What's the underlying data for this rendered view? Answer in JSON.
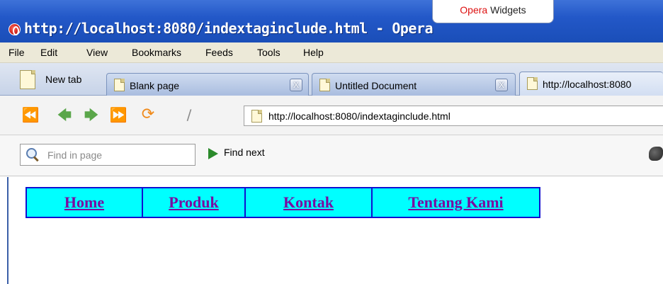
{
  "window": {
    "title": "http://localhost:8080/indextaginclude.html - Opera",
    "widgets_tab": {
      "brand": "Opera",
      "label": "Widgets"
    }
  },
  "menu": [
    "File",
    "Edit",
    "View",
    "Bookmarks",
    "Feeds",
    "Tools",
    "Help"
  ],
  "tabs": {
    "new_tab_label": "New tab",
    "items": [
      {
        "label": "Blank page"
      },
      {
        "label": "Untitled Document"
      },
      {
        "label": "http://localhost:8080"
      }
    ],
    "close_glyph": "X"
  },
  "address": {
    "url": "http://localhost:8080/indextaginclude.html"
  },
  "find": {
    "placeholder": "Find in page",
    "next_label": "Find next"
  },
  "page": {
    "nav_links": [
      "Home",
      "Produk",
      "Kontak",
      "Tentang Kami"
    ],
    "colors": {
      "cell_bg": "#00ffff",
      "border": "#1010d0",
      "link": "#7a0aa0"
    }
  }
}
